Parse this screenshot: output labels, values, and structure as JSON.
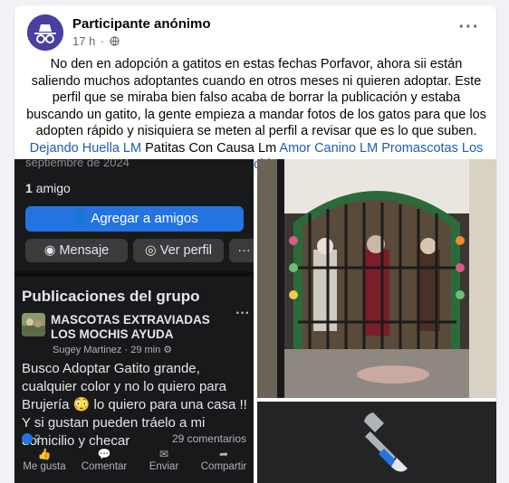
{
  "post": {
    "author": "Participante anónimo",
    "time": "17 h",
    "body_text": "No den en adopción a gatitos en estas fechas Porfavor, ahora sii están saliendo muchos adoptantes cuando en otros meses ni quieren adoptar. Este perfil que se miraba bien falso acaba de borrar la publicación y estaba buscando un gatito, la gente empieza a mandar fotos de los gatos para que los adopten rápido y nisiquiera se meten al perfil a revisar que es lo que suben.",
    "links": [
      "Dejando Huella LM",
      "Amor Canino LM",
      "Promascotas Los Mochis"
    ],
    "plain_between": "Patitas Con Causa Lm"
  },
  "screenshot": {
    "faded_date": "septiembre de 2024",
    "friends_count": "1",
    "friends_label": "amigo",
    "add_friend": "Agregar a amigos",
    "message": "Mensaje",
    "view_profile": "Ver perfil",
    "more": "···",
    "section_title": "Publicaciones del grupo",
    "group_name": "MASCOTAS EXTRAVIADAS LOS MOCHIS AYUDA",
    "group_author": "Sugey Martinez",
    "group_time": "29 min",
    "group_text": "Busco Adoptar Gatito grande, cualquier color y no lo quiero para Brujería 😳 lo quiero para una casa !! Y si gustan pueden tráelo a mi domicilio y checar",
    "reactions": "2",
    "comments": "29 comentarios",
    "actions": [
      "Me gusta",
      "Comentar",
      "Enviar",
      "Compartir"
    ]
  },
  "colors": {
    "accent": "#2374e1",
    "link": "#1a5fb4",
    "dark_bg": "#18191a"
  },
  "icons": [
    "incognito-avatar-icon",
    "globe-icon",
    "more-options-icon",
    "add-friend-icon",
    "messenger-icon",
    "profile-icon",
    "like-icon",
    "comment-icon",
    "send-icon",
    "share-icon",
    "wrench-icon"
  ]
}
